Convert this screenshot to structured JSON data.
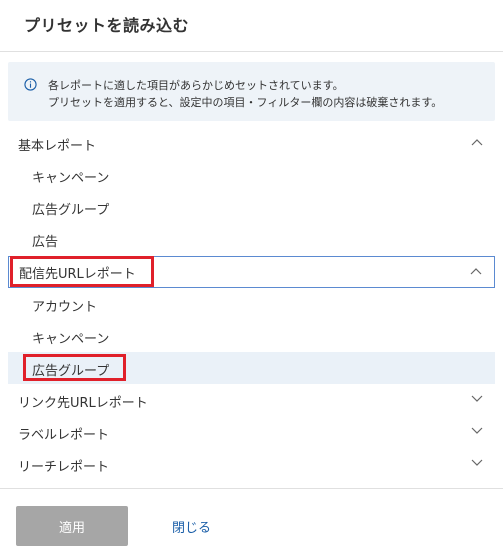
{
  "dialog": {
    "title": "プリセットを読み込む"
  },
  "notice": {
    "icon": "info-icon",
    "line1": "各レポートに適した項目があらかじめセットされています。",
    "line2": "プリセットを適用すると、設定中の項目・フィルター欄の内容は破棄されます。"
  },
  "groups": [
    {
      "label": "基本レポート",
      "expanded": true,
      "items": [
        "キャンペーン",
        "広告グループ",
        "広告"
      ]
    },
    {
      "label": "配信先URLレポート",
      "expanded": true,
      "items": [
        "アカウント",
        "キャンペーン",
        "広告グループ"
      ]
    },
    {
      "label": "リンク先URLレポート",
      "expanded": false,
      "items": []
    },
    {
      "label": "ラベルレポート",
      "expanded": false,
      "items": []
    },
    {
      "label": "リーチレポート",
      "expanded": false,
      "items": []
    }
  ],
  "selected_item": "広告グループ",
  "colors": {
    "highlight": "#e0202a",
    "selected_bg": "#eaf1f8",
    "focus_border": "#5b8ad1",
    "link": "#1a5ea8",
    "disabled_button": "#a6a6a6"
  },
  "footer": {
    "apply_label": "適用",
    "close_label": "閉じる"
  }
}
